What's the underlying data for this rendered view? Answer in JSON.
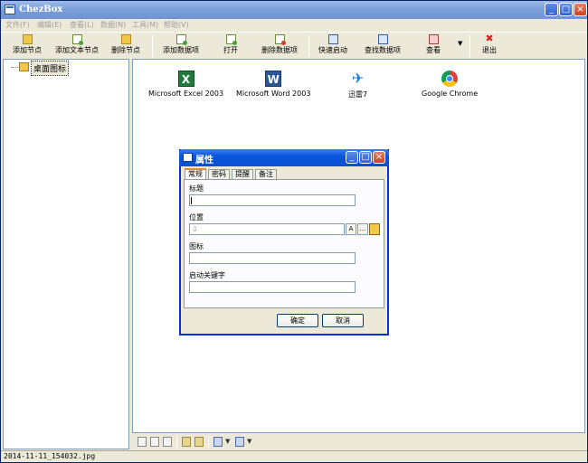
{
  "app": {
    "title": "ChezBox"
  },
  "menu": [
    "文件(F)",
    "编辑(E)",
    "查看(L)",
    "数据(N)",
    "工具(M)",
    "帮助(V)"
  ],
  "toolbar": {
    "add_node": "添加节点",
    "add_text_node": "添加文本节点",
    "delete_node": "删除节点",
    "add_data_item": "添加数据项",
    "open": "打开",
    "delete_data_item": "删除数据项",
    "quick_start": "快速启动",
    "find_data_item": "查找数据项",
    "view": "查看",
    "exit": "退出"
  },
  "tree": {
    "root_label": "桌面图标"
  },
  "desktop_items": [
    {
      "label": "Microsoft Excel 2003",
      "icon": "excel-icon"
    },
    {
      "label": "Microsoft Word 2003",
      "icon": "word-icon"
    },
    {
      "label": "迅雷7",
      "icon": "thunder-icon"
    },
    {
      "label": "Google Chrome",
      "icon": "chrome-icon"
    }
  ],
  "dialog": {
    "title": "属性",
    "tabs": [
      "常规",
      "密码",
      "提醒",
      "备注"
    ],
    "fields": {
      "title_label": "标题",
      "location_label": "位置",
      "icon_label": "图标",
      "keyword_label": "启动关键字"
    },
    "buttons": {
      "ok": "确定",
      "cancel": "取消"
    }
  },
  "status": {
    "text": "2014-11-11_154032.jpg"
  }
}
